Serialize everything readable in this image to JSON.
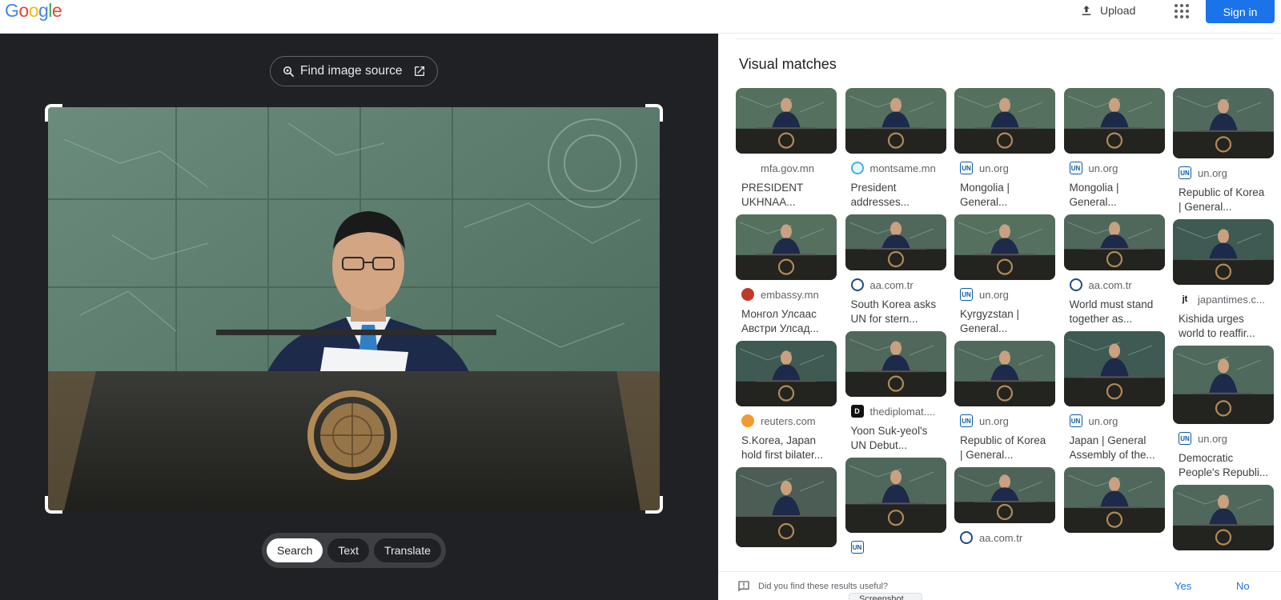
{
  "header": {
    "logo_letters": [
      {
        "ch": "G",
        "color": "#4285f4"
      },
      {
        "ch": "o",
        "color": "#ea4335"
      },
      {
        "ch": "o",
        "color": "#fbbc05"
      },
      {
        "ch": "g",
        "color": "#4285f4"
      },
      {
        "ch": "l",
        "color": "#34a853"
      },
      {
        "ch": "e",
        "color": "#ea4335"
      }
    ],
    "upload_label": "Upload",
    "signin_label": "Sign in"
  },
  "lens": {
    "find_source_label": "Find image source",
    "modes": [
      "Search",
      "Text",
      "Translate"
    ],
    "active_mode": "Search"
  },
  "results": {
    "section_title": "Visual matches",
    "columns": [
      [
        {
          "source": "mfa.gov.mn",
          "favicon": "mfa",
          "title": "PRESIDENT UKHNAA...",
          "thumb_h": 82,
          "tone": "#56705f"
        },
        {
          "source": "embassy.mn",
          "favicon": "embassy",
          "title": "Монгол Улсаас Австри Улсад...",
          "thumb_h": 82,
          "tone": "#56705f"
        },
        {
          "source": "reuters.com",
          "favicon": "reuters",
          "title": "S.Korea, Japan hold first bilater...",
          "thumb_h": 82,
          "tone": "#3e5a52"
        },
        {
          "source": "",
          "favicon": "",
          "title": "",
          "thumb_h": 100,
          "tone": "#4b5d55"
        }
      ],
      [
        {
          "source": "montsame.mn",
          "favicon": "montsame",
          "title": "President addresses...",
          "thumb_h": 82,
          "tone": "#56705f"
        },
        {
          "source": "aa.com.tr",
          "favicon": "aa",
          "title": "South Korea asks UN for stern...",
          "thumb_h": 70,
          "tone": "#50685c"
        },
        {
          "source": "thediplomat....",
          "favicon": "diplomat",
          "title": "Yoon Suk-yeol's UN Debut...",
          "thumb_h": 82,
          "tone": "#50685c"
        },
        {
          "source": "",
          "favicon": "un",
          "title": "",
          "thumb_h": 94,
          "tone": "#50685c"
        }
      ],
      [
        {
          "source": "un.org",
          "favicon": "un",
          "title": "Mongolia | General...",
          "thumb_h": 82,
          "tone": "#56705f"
        },
        {
          "source": "un.org",
          "favicon": "un",
          "title": "Kyrgyzstan | General...",
          "thumb_h": 82,
          "tone": "#55705f"
        },
        {
          "source": "un.org",
          "favicon": "un",
          "title": "Republic of Korea | General...",
          "thumb_h": 82,
          "tone": "#4f6a5d"
        },
        {
          "source": "aa.com.tr",
          "favicon": "aa",
          "title": "",
          "thumb_h": 70,
          "tone": "#4e6459"
        }
      ],
      [
        {
          "source": "un.org",
          "favicon": "un",
          "title": "Mongolia | General...",
          "thumb_h": 82,
          "tone": "#56705f"
        },
        {
          "source": "aa.com.tr",
          "favicon": "aa",
          "title": "World must stand together as...",
          "thumb_h": 70,
          "tone": "#50685c"
        },
        {
          "source": "un.org",
          "favicon": "un",
          "title": "Japan | General Assembly of the...",
          "thumb_h": 94,
          "tone": "#3e5a52"
        },
        {
          "source": "",
          "favicon": "",
          "title": "",
          "thumb_h": 82,
          "tone": "#50685c"
        }
      ],
      [
        {
          "source": "un.org",
          "favicon": "un",
          "title": "Republic of Korea | General...",
          "thumb_h": 88,
          "tone": "#4f6a5d"
        },
        {
          "source": "japantimes.c...",
          "favicon": "jt",
          "title": "Kishida urges world to reaffir...",
          "thumb_h": 82,
          "tone": "#3e5a52"
        },
        {
          "source": "un.org",
          "favicon": "un",
          "title": "Democratic People's Republi...",
          "thumb_h": 98,
          "tone": "#4f6a5d"
        },
        {
          "source": "",
          "favicon": "",
          "title": "",
          "thumb_h": 82,
          "tone": "#50685c"
        }
      ]
    ],
    "feedback_question": "Did you find these results useful?",
    "feedback_yes": "Yes",
    "feedback_no": "No",
    "chip_label": "Screenshot"
  }
}
